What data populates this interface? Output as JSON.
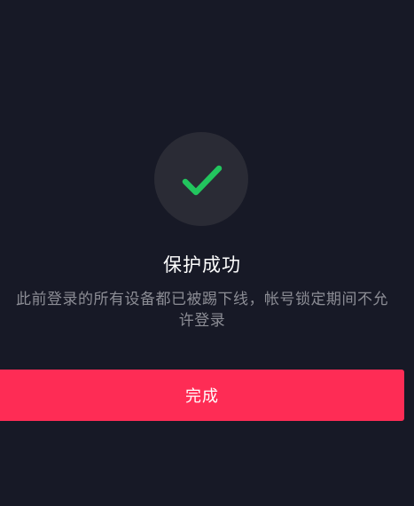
{
  "result": {
    "icon": "checkmark-icon",
    "title": "保护成功",
    "description": "此前登录的所有设备都已被踢下线，帐号锁定期间不允许登录"
  },
  "actions": {
    "done_label": "完成"
  },
  "colors": {
    "background": "#171926",
    "icon_circle": "#2a2b35",
    "check_green": "#22c55e",
    "primary_button": "#fe2c55",
    "secondary_text": "#8c8d95"
  }
}
